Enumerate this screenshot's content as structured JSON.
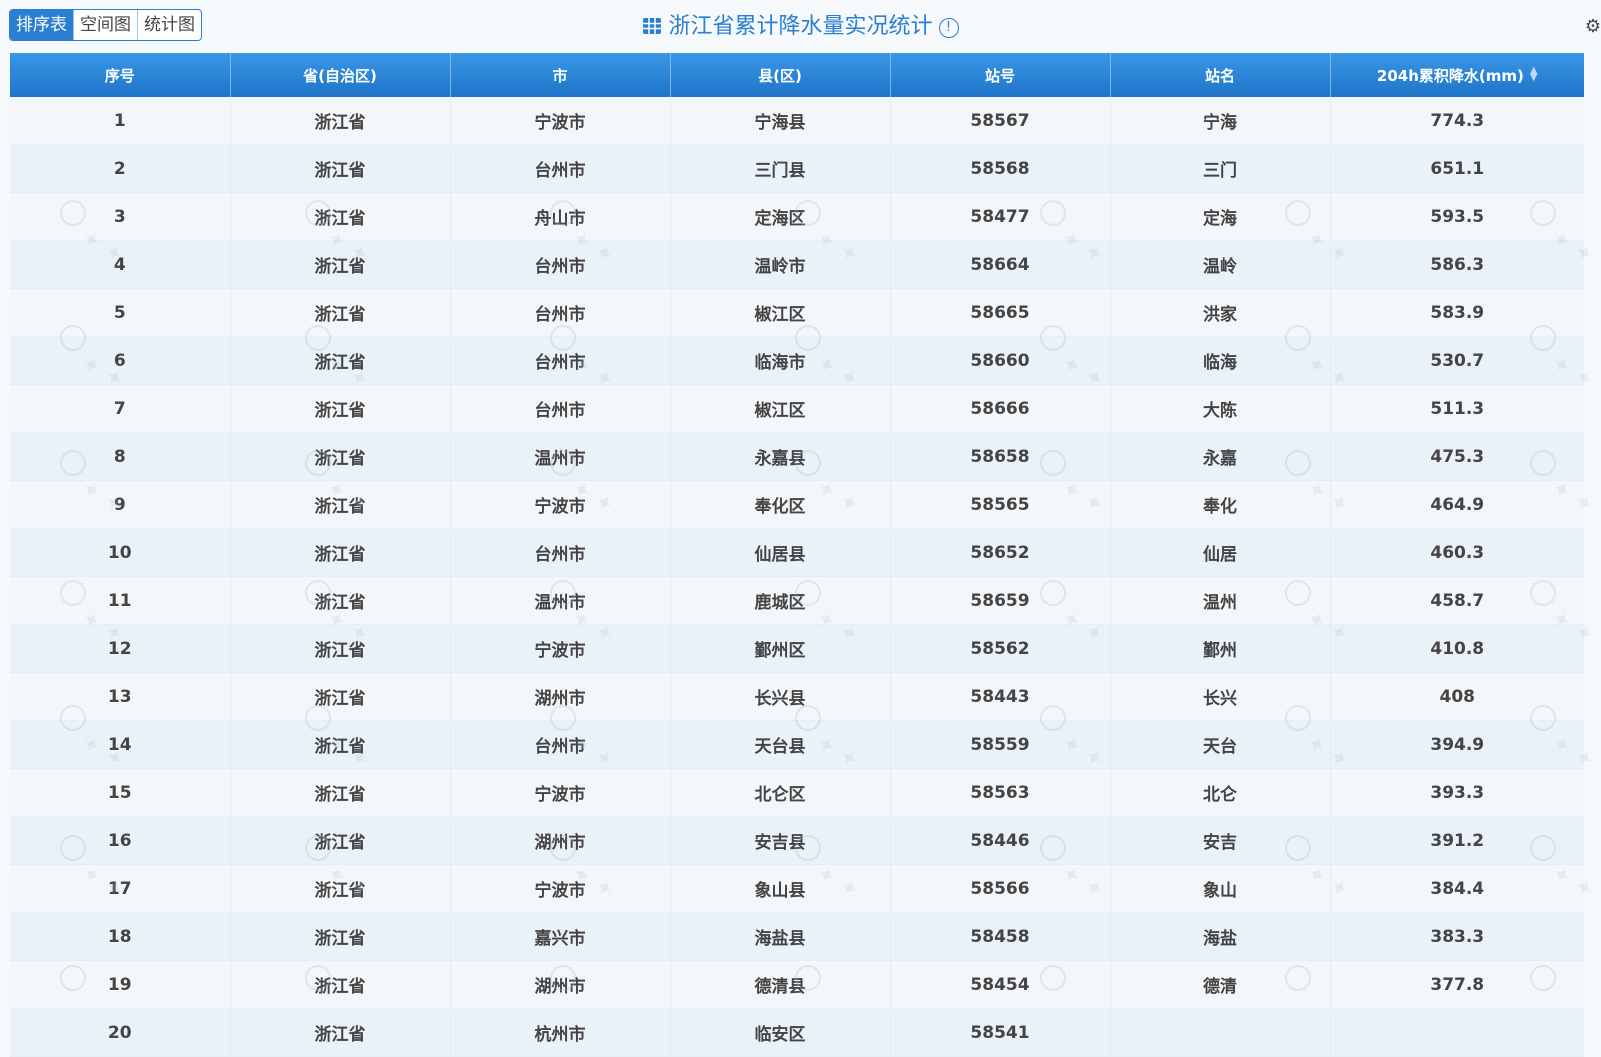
{
  "tabs": [
    {
      "label": "排序表",
      "active": true
    },
    {
      "label": "空间图",
      "active": false
    },
    {
      "label": "统计图",
      "active": false
    }
  ],
  "title": "浙江省累计降水量实况统计",
  "info_icon": "info-icon",
  "settings_icon": "gear-icon",
  "colors": {
    "accent": "#2a7fd1",
    "header": "#1f74c8"
  },
  "table": {
    "columns": [
      "序号",
      "省(自治区)",
      "市",
      "县(区)",
      "站号",
      "站名",
      "204h累积降水(mm)"
    ],
    "rows": [
      [
        "1",
        "浙江省",
        "宁波市",
        "宁海县",
        "58567",
        "宁海",
        "774.3"
      ],
      [
        "2",
        "浙江省",
        "台州市",
        "三门县",
        "58568",
        "三门",
        "651.1"
      ],
      [
        "3",
        "浙江省",
        "舟山市",
        "定海区",
        "58477",
        "定海",
        "593.5"
      ],
      [
        "4",
        "浙江省",
        "台州市",
        "温岭市",
        "58664",
        "温岭",
        "586.3"
      ],
      [
        "5",
        "浙江省",
        "台州市",
        "椒江区",
        "58665",
        "洪家",
        "583.9"
      ],
      [
        "6",
        "浙江省",
        "台州市",
        "临海市",
        "58660",
        "临海",
        "530.7"
      ],
      [
        "7",
        "浙江省",
        "台州市",
        "椒江区",
        "58666",
        "大陈",
        "511.3"
      ],
      [
        "8",
        "浙江省",
        "温州市",
        "永嘉县",
        "58658",
        "永嘉",
        "475.3"
      ],
      [
        "9",
        "浙江省",
        "宁波市",
        "奉化区",
        "58565",
        "奉化",
        "464.9"
      ],
      [
        "10",
        "浙江省",
        "台州市",
        "仙居县",
        "58652",
        "仙居",
        "460.3"
      ],
      [
        "11",
        "浙江省",
        "温州市",
        "鹿城区",
        "58659",
        "温州",
        "458.7"
      ],
      [
        "12",
        "浙江省",
        "宁波市",
        "鄞州区",
        "58562",
        "鄞州",
        "410.8"
      ],
      [
        "13",
        "浙江省",
        "湖州市",
        "长兴县",
        "58443",
        "长兴",
        "408"
      ],
      [
        "14",
        "浙江省",
        "台州市",
        "天台县",
        "58559",
        "天台",
        "394.9"
      ],
      [
        "15",
        "浙江省",
        "宁波市",
        "北仑区",
        "58563",
        "北仑",
        "393.3"
      ],
      [
        "16",
        "浙江省",
        "湖州市",
        "安吉县",
        "58446",
        "安吉",
        "391.2"
      ],
      [
        "17",
        "浙江省",
        "宁波市",
        "象山县",
        "58566",
        "象山",
        "384.4"
      ],
      [
        "18",
        "浙江省",
        "嘉兴市",
        "海盐县",
        "58458",
        "海盐",
        "383.3"
      ],
      [
        "19",
        "浙江省",
        "湖州市",
        "德清县",
        "58454",
        "德清",
        "377.8"
      ],
      [
        "20",
        "浙江省",
        "杭州市",
        "临安区",
        "58541",
        "",
        ""
      ]
    ]
  }
}
